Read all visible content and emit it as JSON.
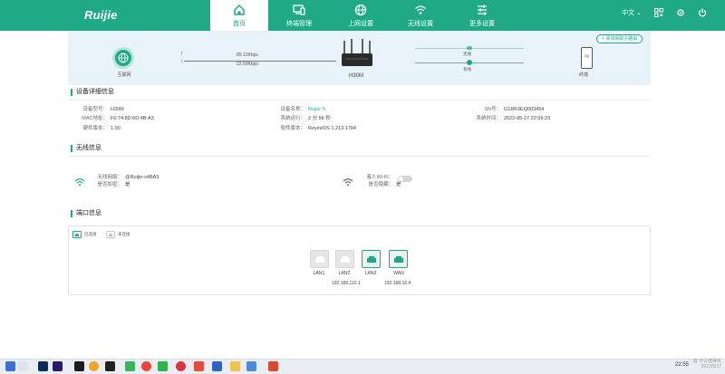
{
  "brand": "Ruijie",
  "nav": [
    {
      "label": "首页",
      "icon": "home-icon",
      "active": true
    },
    {
      "label": "终端管理",
      "icon": "devices-icon"
    },
    {
      "label": "上网设置",
      "icon": "globe-icon"
    },
    {
      "label": "无线设置",
      "icon": "wifi-icon"
    },
    {
      "label": "更多设置",
      "icon": "sliders-icon"
    }
  ],
  "header_right": {
    "language": "中文 ⌄"
  },
  "topology": {
    "internet_label": "互联网",
    "upload_rate": "85.12Kbps",
    "download_rate": "22.59Kbps",
    "router_name": "H30M",
    "wireless_label": "无线",
    "wired_label": "有线",
    "terminal_label": "终端",
    "terminal_count": "2台",
    "add_mesh_label": "+ 添加易联子路由"
  },
  "device_info": {
    "title": "设备详细信息",
    "model_label": "设备型号：",
    "model": "H30M",
    "mac_label": "MAC地址：",
    "mac": "F0:74:8D:6D:4B:A3",
    "hw_label": "硬件版本：",
    "hw": "1.00",
    "name_label": "设备名称：",
    "name": "Ruijie ✎",
    "uptime_label": "系统运行：",
    "uptime": "2 分 56 秒",
    "sw_label": "软件版本：",
    "sw": "ReyeeOS 1.213.1704",
    "sn_label": "SN号：",
    "sn": "G1RK9EQ003454",
    "time_label": "系统时间：",
    "time": "2023-05-27 22:55:23"
  },
  "wireless": {
    "title": "无线信息",
    "ssid_label": "无线网络：",
    "ssid": "@Ruijie-s4BA3",
    "hidden_label": "是否加密：",
    "hidden": "是",
    "guest_label": "客人Wi-Fi：",
    "guest_hidden_label": "是否隐藏：",
    "guest_hidden": "是"
  },
  "ports": {
    "title": "端口信息",
    "legend_connected": "已连接",
    "legend_disconnected": "未连接",
    "list": [
      {
        "name": "LAN1",
        "connected": false
      },
      {
        "name": "LAN2",
        "connected": false
      },
      {
        "name": "LAN3",
        "connected": true
      },
      {
        "name": "WAN",
        "connected": true
      }
    ],
    "lan_ip": "192.168.110.1",
    "wan_ip": "192.168.16.4"
  },
  "taskbar": {
    "time": "22:55",
    "watermark_line1": "值 什么值得买",
    "watermark_line2": "2023/5/27"
  },
  "colors": {
    "accent": "#1fa987",
    "banner": "#e8f3f9"
  }
}
